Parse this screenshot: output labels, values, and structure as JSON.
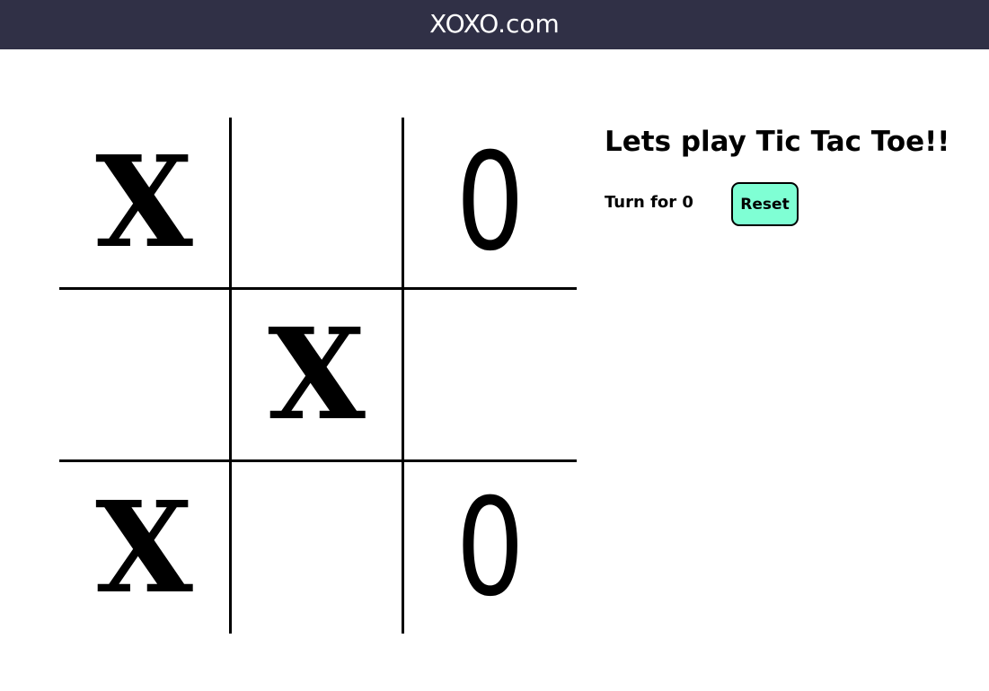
{
  "navbar": {
    "brand": "XOXO.com"
  },
  "game": {
    "title": "Lets play Tic Tac Toe!!",
    "turn_text": "Turn for 0",
    "reset_label": "Reset",
    "board": [
      [
        "X",
        "",
        "0"
      ],
      [
        "",
        "X",
        ""
      ],
      [
        "X",
        "",
        "0"
      ]
    ]
  },
  "colors": {
    "navbar_bg": "#303046",
    "reset_bg": "#7fffd4",
    "text": "#000000"
  }
}
